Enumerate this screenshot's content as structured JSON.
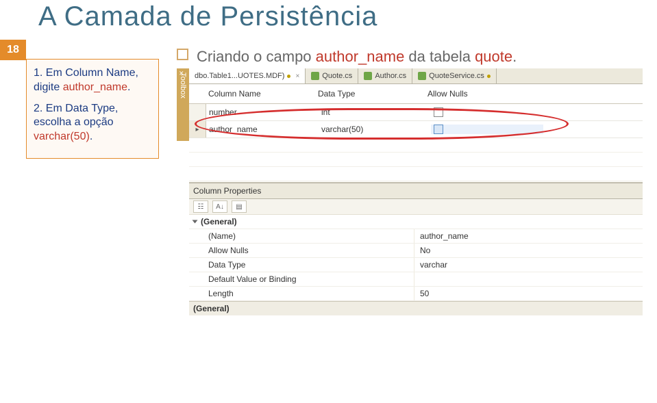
{
  "page": {
    "title": "A Camada de Persistência",
    "number": "18"
  },
  "sidebox": {
    "step1_pre": "1. Em ",
    "step1_kw": "Column Name",
    "step1_mid": ", digite ",
    "step1_val": "author_name",
    "step1_end": ".",
    "step2_pre": "2. Em ",
    "step2_kw": "Data Type",
    "step2_mid": ", escolha a opção ",
    "step2_val": "varchar(50)",
    "step2_end": "."
  },
  "bullet": {
    "pre": "Criando o campo ",
    "kw1": "author_name",
    "mid": " da tabela ",
    "kw2": "quote",
    "end": "."
  },
  "vs": {
    "toolbox": "Toolbox",
    "tabs": [
      {
        "label": "dbo.Table1...UOTES.MDF)",
        "active": true,
        "dirty": true
      },
      {
        "label": "Quote.cs",
        "active": false,
        "dirty": false
      },
      {
        "label": "Author.cs",
        "active": false,
        "dirty": false
      },
      {
        "label": "QuoteService.cs",
        "active": false,
        "dirty": true
      }
    ],
    "grid": {
      "headers": {
        "c1": "Column Name",
        "c2": "Data Type",
        "c3": "Allow Nulls"
      },
      "rows": [
        {
          "name": "number",
          "type": "int",
          "nulls": false,
          "selected": false
        },
        {
          "name": "author_name",
          "type": "varchar(50)",
          "nulls": false,
          "selected": true
        }
      ]
    },
    "props": {
      "title": "Column Properties",
      "category": "(General)",
      "rows": [
        {
          "k": "(Name)",
          "v": "author_name"
        },
        {
          "k": "Allow Nulls",
          "v": "No"
        },
        {
          "k": "Data Type",
          "v": "varchar"
        },
        {
          "k": "Default Value or Binding",
          "v": ""
        },
        {
          "k": "Length",
          "v": "50"
        }
      ],
      "footer": "(General)"
    }
  }
}
